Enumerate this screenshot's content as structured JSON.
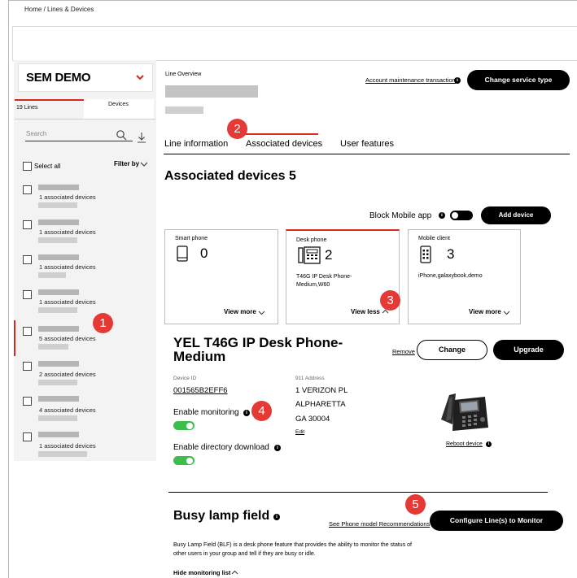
{
  "breadcrumb": "Home  /  Lines & Devices",
  "account": {
    "name": "SEM DEMO"
  },
  "sidebar": {
    "tab_lines": "19 Lines",
    "tab_devices": "Devices",
    "search_placeholder": "Search",
    "select_all": "Select all",
    "filter_by": "Filter by",
    "items": [
      {
        "text": "1 associated devices"
      },
      {
        "text": "1 associated devices"
      },
      {
        "text": "1 associated devices"
      },
      {
        "text": "1 associated devices"
      },
      {
        "text": "5 associated devices"
      },
      {
        "text": "2 associated devices"
      },
      {
        "text": "4 associated devices"
      },
      {
        "text": "1 associated devices"
      }
    ]
  },
  "header": {
    "line_overview": "Line Overview",
    "account_maintenance": "Account maintenance transaction",
    "change_service_type": "Change service type"
  },
  "tabs": [
    "Line information",
    "Associated devices",
    "User features"
  ],
  "associated": {
    "title": "Associated devices 5",
    "block_mobile": "Block Mobile app",
    "add_device": "Add device",
    "cards": [
      {
        "title": "Smart phone",
        "count": "0",
        "detail": "",
        "link": "View more"
      },
      {
        "title": "Desk phone",
        "count": "2",
        "detail": "T46G IP Desk Phone-Medium,W60",
        "link": "View less"
      },
      {
        "title": "Mobile client",
        "count": "3",
        "detail": "iPhone,galaxybook,demo",
        "link": "View more"
      }
    ]
  },
  "device": {
    "title": "YEL T46G IP Desk Phone-Medium",
    "remove": "Remove",
    "change": "Change",
    "upgrade": "Upgrade",
    "device_id_label": "Device ID",
    "device_id": "001565B2EFF6",
    "address_label": "911 Address",
    "address_1": "1 VERIZON PL",
    "address_2": "ALPHARETTA",
    "address_3": "GA  30004",
    "edit": "Edit",
    "enable_monitoring": "Enable monitoring",
    "enable_directory": "Enable directory download",
    "reboot": "Reboot device"
  },
  "blf": {
    "title": "Busy lamp field",
    "recommendations": "See Phone model Recommendations",
    "configure": "Configure Line(s) to Monitor",
    "description": "Busy Lamp Field (BLF) is a desk phone feature that provides the ability to monitor the status of other users in your group and tell if they are busy or idle.",
    "hide_list": "Hide monitoring list"
  },
  "badges": [
    "1",
    "2",
    "3",
    "4",
    "5"
  ],
  "colors": {
    "accent": "#d52b1e",
    "badge": "#e53935",
    "toggle_on": "#3dbd4b"
  }
}
